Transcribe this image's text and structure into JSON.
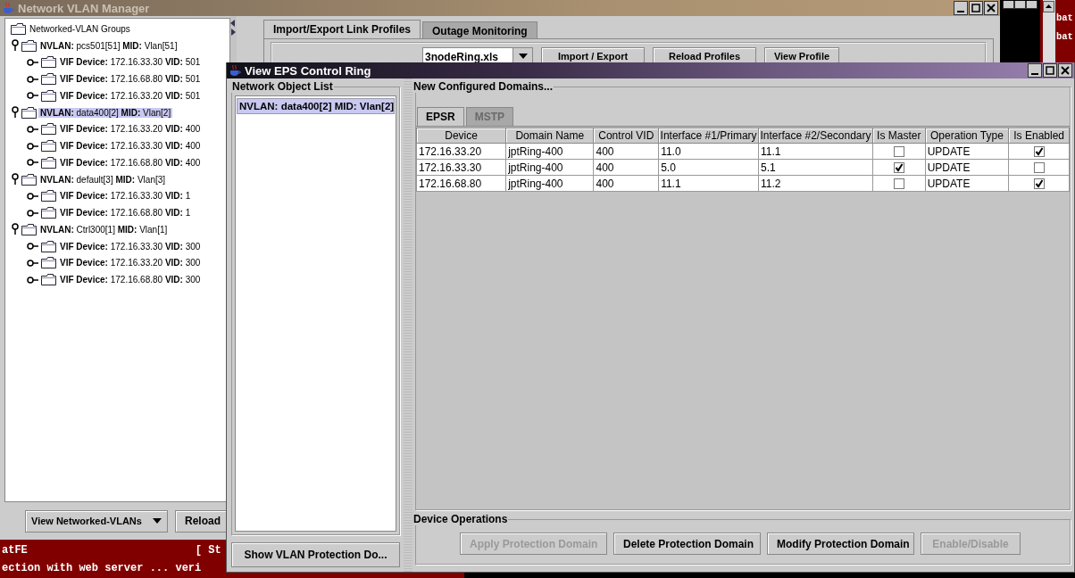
{
  "main_window": {
    "title": "Network VLAN Manager"
  },
  "tree": {
    "root": "Networked-VLAN Groups",
    "items": [
      {
        "label": "**NVLAN:** pcs501[51] **MID:** Vlan[51]",
        "expanded": true,
        "selected": false,
        "children": [
          {
            "label": "**VIF Device:** 172.16.33.30 **VID:** 501",
            "expanded": false,
            "selected": false
          },
          {
            "label": "**VIF Device:** 172.16.68.80 **VID:** 501",
            "expanded": false,
            "selected": false
          },
          {
            "label": "**VIF Device:** 172.16.33.20 **VID:** 501",
            "expanded": false,
            "selected": false
          }
        ]
      },
      {
        "label": "**NVLAN:** data400[2] **MID:** Vlan[2]",
        "expanded": true,
        "selected": true,
        "children": [
          {
            "label": "**VIF Device:** 172.16.33.20 **VID:** 400",
            "expanded": false,
            "selected": false
          },
          {
            "label": "**VIF Device:** 172.16.33.30 **VID:** 400",
            "expanded": false,
            "selected": false
          },
          {
            "label": "**VIF Device:** 172.16.68.80 **VID:** 400",
            "expanded": false,
            "selected": false
          }
        ]
      },
      {
        "label": "**NVLAN:** default[3] **MID:** Vlan[3]",
        "expanded": true,
        "selected": false,
        "children": [
          {
            "label": "**VIF Device:** 172.16.33.30 **VID:** 1",
            "expanded": false,
            "selected": false
          },
          {
            "label": "**VIF Device:** 172.16.68.80 **VID:** 1",
            "expanded": false,
            "selected": false
          }
        ]
      },
      {
        "label": "**NVLAN:** Ctrl300[1] **MID:** Vlan[1]",
        "expanded": true,
        "selected": false,
        "children": [
          {
            "label": "**VIF Device:** 172.16.33.30 **VID:** 300",
            "expanded": false,
            "selected": false
          },
          {
            "label": "**VIF Device:** 172.16.33.20 **VID:** 300",
            "expanded": false,
            "selected": false
          },
          {
            "label": "**VIF Device:** 172.16.68.80 **VID:** 300",
            "expanded": false,
            "selected": false
          }
        ]
      }
    ]
  },
  "view_selector": "View Networked-VLANs",
  "reload_button": "Reload",
  "tabs": [
    {
      "label": "Import/Export Link Profiles",
      "selected": true
    },
    {
      "label": "Outage Monitoring",
      "selected": false
    }
  ],
  "profile_file": "3nodeRing.xls",
  "profile_buttons": [
    "Import / Export",
    "Reload Profiles",
    "View Profile"
  ],
  "console_left": {
    "lines": [
      {
        "text": "atFE",
        "status": "[ St"
      },
      {
        "text": "ection with web server ... veri"
      }
    ]
  },
  "console_right": {
    "lines": [
      "bat",
      "bat"
    ]
  },
  "dialog": {
    "title": "View EPS Control Ring",
    "object_list": {
      "title": "Network Object List",
      "items": [
        {
          "label": "NVLAN: data400[2] MID: Vlan[2]",
          "selected": true
        }
      ],
      "button": "Show VLAN Protection Do..."
    },
    "domains": {
      "title": "New Configured Domains...",
      "tabs": [
        {
          "label": "EPSR",
          "selected": true,
          "disabled": false
        },
        {
          "label": "MSTP",
          "selected": false,
          "disabled": true
        }
      ],
      "columns": [
        "Device",
        "Domain Name",
        "Control VID",
        "Interface #1/Primary",
        "Interface #2/Secondary",
        "Is Master",
        "Operation Type",
        "Is Enabled"
      ],
      "rows": [
        {
          "cells": [
            "172.16.33.20",
            "jptRing-400",
            "400",
            "11.0",
            "11.1"
          ],
          "is_master": false,
          "operation": "UPDATE",
          "is_enabled": true
        },
        {
          "cells": [
            "172.16.33.30",
            "jptRing-400",
            "400",
            "5.0",
            "5.1"
          ],
          "is_master": true,
          "operation": "UPDATE",
          "is_enabled": false
        },
        {
          "cells": [
            "172.16.68.80",
            "jptRing-400",
            "400",
            "11.1",
            "11.2"
          ],
          "is_master": false,
          "operation": "UPDATE",
          "is_enabled": true
        }
      ]
    },
    "operations": {
      "title": "Device Operations",
      "buttons": [
        {
          "label": "Apply Protection Domain",
          "disabled": true
        },
        {
          "label": "Delete Protection Domain",
          "disabled": false
        },
        {
          "label": "Modify Protection Domain",
          "disabled": false
        },
        {
          "label": "Enable/Disable",
          "disabled": true
        }
      ]
    }
  }
}
